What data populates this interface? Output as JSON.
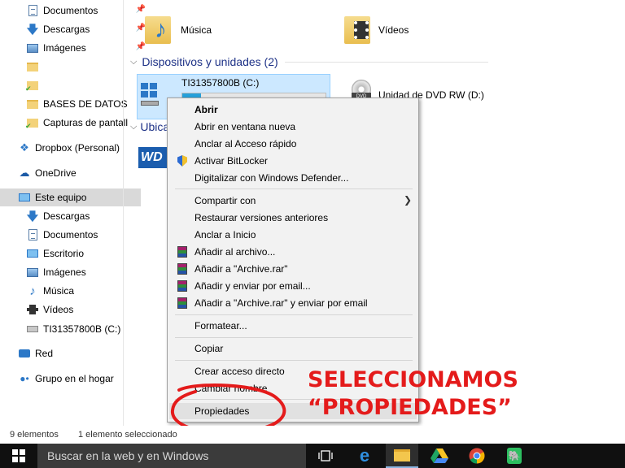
{
  "nav": {
    "quick_access": [
      {
        "label": "Documentos",
        "icon": "document-icon",
        "pinned": true
      },
      {
        "label": "Descargas",
        "icon": "download-arrow-icon",
        "pinned": true
      },
      {
        "label": "Imágenes",
        "icon": "images-icon",
        "pinned": true
      },
      {
        "label": "",
        "icon": "folder-icon",
        "pinned": false
      },
      {
        "label": "",
        "icon": "folder-sync-icon",
        "pinned": false
      },
      {
        "label": "BASES DE DATOS",
        "icon": "folder-icon",
        "pinned": false
      },
      {
        "label": "Capturas de pantall",
        "icon": "folder-sync-icon",
        "pinned": false
      }
    ],
    "dropbox": "Dropbox (Personal)",
    "onedrive": "OneDrive",
    "this_pc": "Este equipo",
    "this_pc_children": [
      {
        "label": "Descargas",
        "icon": "download-arrow-icon"
      },
      {
        "label": "Documentos",
        "icon": "document-icon"
      },
      {
        "label": "Escritorio",
        "icon": "desktop-icon"
      },
      {
        "label": "Imágenes",
        "icon": "images-icon"
      },
      {
        "label": "Música",
        "icon": "music-icon"
      },
      {
        "label": "Vídeos",
        "icon": "video-icon"
      },
      {
        "label": "TI31357800B (C:)",
        "icon": "drive-icon"
      }
    ],
    "network": "Red",
    "homegroup": "Grupo en el hogar"
  },
  "content": {
    "folders": [
      {
        "label": "Música",
        "icon": "music-folder-icon"
      },
      {
        "label": "Vídeos",
        "icon": "video-folder-icon"
      }
    ],
    "devices_header": "Dispositivos y unidades (2)",
    "drive_c": {
      "label": "TI31357800B (C:)",
      "used_fraction": 0.13
    },
    "dvd_drive": {
      "label": "Unidad de DVD RW (D:)"
    },
    "locations_header_fragment": "Ubica"
  },
  "context_menu": {
    "items": [
      {
        "label": "Abrir",
        "bold": true,
        "icon": ""
      },
      {
        "label": "Abrir en ventana nueva",
        "icon": ""
      },
      {
        "label": "Anclar al Acceso rápido",
        "icon": ""
      },
      {
        "label": "Activar BitLocker",
        "icon": "shield-icon"
      },
      {
        "label": "Digitalizar con Windows Defender...",
        "icon": ""
      },
      {
        "label": "Compartir con",
        "icon": "",
        "submenu": true
      },
      {
        "label": "Restaurar versiones anteriores",
        "icon": ""
      },
      {
        "label": "Anclar a Inicio",
        "icon": ""
      },
      {
        "label": "Añadir al archivo...",
        "icon": "winrar-icon"
      },
      {
        "label": "Añadir a \"Archive.rar\"",
        "icon": "winrar-icon"
      },
      {
        "label": "Añadir y enviar por email...",
        "icon": "winrar-icon"
      },
      {
        "label": "Añadir a \"Archive.rar\" y enviar por email",
        "icon": "winrar-icon"
      },
      {
        "label": "Formatear...",
        "icon": ""
      },
      {
        "label": "Copiar",
        "icon": ""
      },
      {
        "label": "Crear acceso directo",
        "icon": ""
      },
      {
        "label": "Cambiar nombre",
        "icon": ""
      },
      {
        "label": "Propiedades",
        "icon": "",
        "highlighted": true
      }
    ]
  },
  "annotation": {
    "line1": "SELECCIONAMOS",
    "line2": "“PROPIEDADES”",
    "color": "#e41b1b"
  },
  "status_bar": {
    "count": "9 elementos",
    "selected": "1 elemento seleccionado"
  },
  "taskbar": {
    "search_placeholder": "Buscar en la web y en Windows",
    "icons": [
      "windows-start-icon",
      "task-view-icon",
      "edge-icon",
      "file-explorer-icon",
      "google-drive-icon",
      "chrome-icon",
      "evernote-icon"
    ]
  }
}
